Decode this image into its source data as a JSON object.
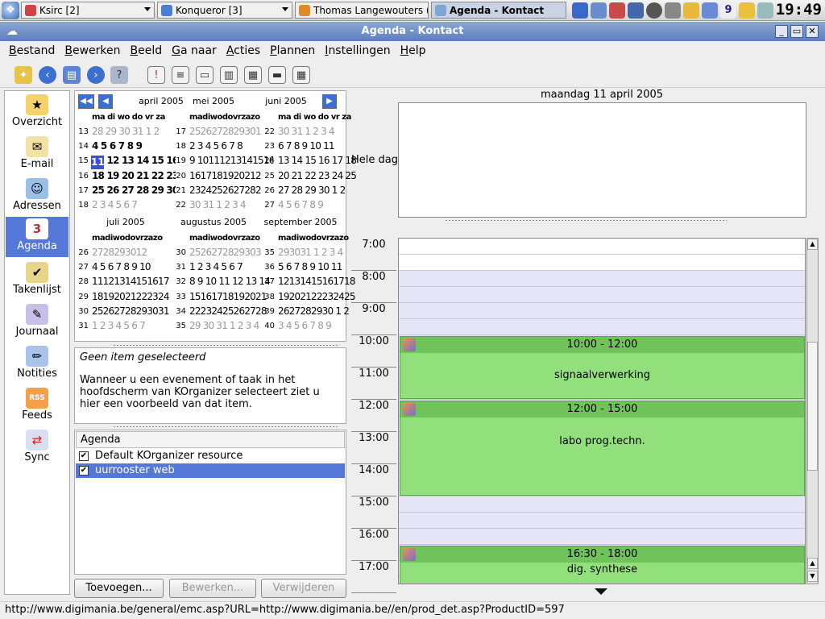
{
  "taskbar": {
    "windows": [
      {
        "label": "Ksirc [2]"
      },
      {
        "label": "Konqueror [3]"
      },
      {
        "label": "Thomas Langewouters (C"
      },
      {
        "label": "Agenda - Kontact"
      }
    ],
    "tray_badge": "9",
    "clock": "19:49"
  },
  "window": {
    "title": "Agenda - Kontact"
  },
  "menu": [
    "Bestand",
    "Bewerken",
    "Beeld",
    "Ga naar",
    "Acties",
    "Plannen",
    "Instellingen",
    "Help"
  ],
  "sidebar": {
    "items": [
      {
        "label": "Overzicht",
        "icon": "star-icon"
      },
      {
        "label": "E-mail",
        "icon": "envelope-icon"
      },
      {
        "label": "Adressen",
        "icon": "people-icon"
      },
      {
        "label": "Agenda",
        "icon": "calendar-icon",
        "active": true
      },
      {
        "label": "Takenlijst",
        "icon": "checklist-icon"
      },
      {
        "label": "Journaal",
        "icon": "journal-icon"
      },
      {
        "label": "Notities",
        "icon": "notes-icon"
      },
      {
        "label": "Feeds",
        "icon": "rss-icon"
      },
      {
        "label": "Sync",
        "icon": "sync-icon"
      }
    ]
  },
  "datenav": {
    "months": [
      {
        "name": "april 2005",
        "heads": "ma di wo do vr za",
        "weeks": [
          "13",
          "14",
          "15",
          "16",
          "17",
          "18"
        ],
        "rows": [
          "28 29 30 31 1 2",
          "4 5 6 7 8 9",
          "11 12 13 14 15 16",
          "18 19 20 21 22 23",
          "25 26 27 28 29 30",
          "2 3 4 5 6 7"
        ]
      },
      {
        "name": "mei 2005",
        "heads": "madiwodovrzazo",
        "weeks": [
          "17",
          "18",
          "19",
          "20",
          "21",
          "22"
        ],
        "rows": [
          "2526272829301",
          "2 3 4 5 6 7 8",
          "9 10111213141516",
          "1617181920212",
          "2324252627282",
          "30 31 1 2 3 4"
        ]
      },
      {
        "name": "juni 2005",
        "heads": "ma di wo do vr za",
        "weeks": [
          "22",
          "23",
          "24",
          "25",
          "26",
          "27"
        ],
        "rows": [
          "30 31 1 2 3 4",
          "6 7 8 9 10 11",
          "13 14 15 16 17 18",
          "20 21 22 23 24 25",
          "27 28 29 30 1 2",
          "4 5 6 7 8 9"
        ]
      },
      {
        "name": "juli 2005",
        "heads": "madiwodovrzazo",
        "weeks": [
          "26",
          "27",
          "28",
          "29",
          "30",
          "31"
        ],
        "rows": [
          "2728293012",
          "4 5 6 7 8 9 10",
          "11121314151617",
          "18192021222324",
          "25262728293031",
          "1 2 3 4 5 6 7"
        ]
      },
      {
        "name": "augustus 2005",
        "heads": "madiwodovrzazo",
        "weeks": [
          "30",
          "31",
          "32",
          "33",
          "34",
          "35"
        ],
        "rows": [
          "2526272829303",
          "1 2 3 4 5 6 7",
          "8 9 10 11 12 13 14",
          "15161718192021",
          "22232425262728",
          "29 30 31 1 2 3 4"
        ]
      },
      {
        "name": "september 2005",
        "heads": "madiwodovrzazo",
        "weeks": [
          "35",
          "36",
          "37",
          "38",
          "39",
          "40"
        ],
        "rows": [
          "293031 1 2 3 4",
          "5 6 7 8 9 10 11",
          "12131415161718",
          "19202122232425",
          "2627282930 1 2",
          "3 4 5 6 7 8 9"
        ]
      }
    ],
    "selected_day": "11"
  },
  "preview": {
    "title": "Geen item geselecteerd",
    "body": "Wanneer u een evenement of taak in het hoofdscherm van KOrganizer selecteert ziet u hier een voorbeeld van dat item."
  },
  "resources": {
    "header": "Agenda",
    "items": [
      {
        "label": "Default KOrganizer resource",
        "checked": true
      },
      {
        "label": "uurrooster web",
        "checked": true,
        "selected": true
      }
    ]
  },
  "buttons": {
    "add": "Toevoegen...",
    "edit": "Bewerken...",
    "delete": "Verwijderen"
  },
  "agenda": {
    "date": "maandag 11 april 2005",
    "allday_label": "Hele dag",
    "hours": [
      "7:00",
      "8:00",
      "9:00",
      "10:00",
      "11:00",
      "12:00",
      "13:00",
      "14:00",
      "15:00",
      "16:00",
      "17:00"
    ],
    "events": [
      {
        "time": "10:00 - 12:00",
        "title": "signaalverwerking"
      },
      {
        "time": "12:00 - 15:00",
        "title": "labo prog.techn."
      },
      {
        "time": "16:30 - 18:00",
        "title": "dig. synthese"
      }
    ]
  },
  "status": "http://www.digimania.be/general/emc.asp?URL=http://www.digimania.be//en/prod_det.asp?ProductID=597"
}
